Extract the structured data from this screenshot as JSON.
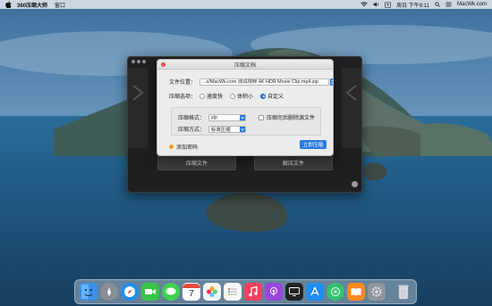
{
  "menubar": {
    "app_name": "360压缩大师",
    "menu_window": "窗口",
    "datetime": "周日 下午9:11",
    "site": "MacWk.com",
    "status_icons": [
      "wifi-icon",
      "volume-icon",
      "input-method-icon",
      "spotlight-icon",
      "control-center-icon"
    ]
  },
  "main_window": {
    "compress_file_label": "压缩文件",
    "extract_file_label": "解压文件"
  },
  "dialog": {
    "title": "压缩文档",
    "file_location_label": "文件位置：",
    "file_path_value": "...s/MacWk.com 测试视频 4K HDR Movie Clip.mp4.zip",
    "browse_label": "...",
    "compress_option_label": "压缩选项：",
    "options": [
      {
        "label": "速度快",
        "checked": false
      },
      {
        "label": "体积小",
        "checked": false
      },
      {
        "label": "自定义",
        "checked": true
      }
    ],
    "format_label": "压缩格式：",
    "format_value": "zip",
    "method_label": "压缩方式：",
    "method_value": "标准压缩",
    "delete_source_label": "压缩完后删除源文件",
    "delete_source_checked": false,
    "add_password_label": "添加密码",
    "start_button_label": "立即压缩"
  },
  "dock": {
    "apps": [
      "finder-icon",
      "launchpad-icon",
      "safari-icon",
      "facetime-icon",
      "messages-icon",
      "calendar-icon",
      "photos-icon",
      "reminders-icon",
      "music-icon",
      "podcasts-icon",
      "tv-icon",
      "app-store-icon",
      "find-my-icon",
      "books-icon",
      "system-preferences-icon",
      "trash-icon"
    ],
    "calendar_month": "7",
    "colors": {
      "finder": "#3b8fe8",
      "launchpad": "#8a8d96",
      "safari": "#1d8ff0",
      "facetime": "#3ac34a",
      "messages": "#3ed24e",
      "photos": "#f3f3f3",
      "reminders": "#f7f7f7",
      "music": "#fb3e5c",
      "podcasts": "#9b45dc",
      "tv": "#222222",
      "app_store": "#1e8cf3",
      "find_my": "#33c26e",
      "books": "#ff8a1f",
      "system_preferences": "#8f949b",
      "trash": "#d9dde2"
    }
  },
  "colors": {
    "accent": "#2a7ae2",
    "main_window_bg": "#1f1f21",
    "dialog_bg": "#ececec"
  }
}
